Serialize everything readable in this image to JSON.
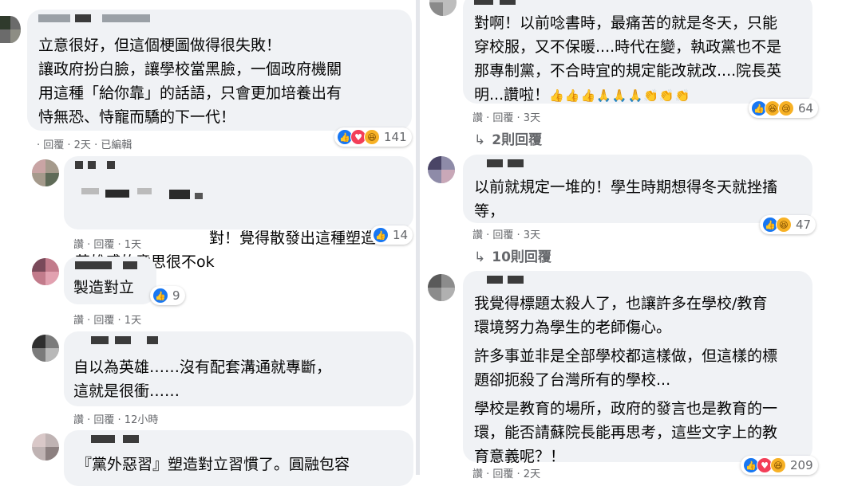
{
  "left_column": {
    "comment1": {
      "text": "立意很好，但這個梗圖做得很失敗！\n讓政府扮白臉，讓學校當黑臉，一個政府機關\n用這種「給你靠」的話語，只會更加培養出有\n恃無恐、恃寵而驕的下一代！",
      "meta": "· 回覆 · 2天 · 已編輯",
      "reaction_count": "141"
    },
    "comment2": {
      "text": "對！覺得散發出這種塑造\n英雄感的意思很不ok",
      "meta": "讚 · 回覆 · 1天",
      "reaction_count": "14"
    },
    "comment3": {
      "text": "製造對立",
      "meta": "讚 · 回覆 · 1天",
      "reaction_count": "9"
    },
    "comment4": {
      "text": "自以為英雄……沒有配套溝通就專斷，\n這就是很衝……",
      "meta": "讚 · 回覆 · 12小時"
    },
    "comment5": {
      "text": "『黨外惡習』塑造對立習慣了。圓融包容"
    }
  },
  "right_column": {
    "comment1": {
      "text": "對啊！以前唸書時，最痛苦的就是冬天，只能\n穿校服，又不保暖....時代在變，執政黨也不是\n那專制黨，不合時宜的規定能改就改....院長英\n明...讚啦！",
      "emojis": "👍👍👍🙏🙏🙏👏👏👏",
      "meta": "讚 · 回覆 · 3天",
      "reaction_count": "64",
      "replies": "2則回覆"
    },
    "comment2": {
      "text": "以前就規定一堆的！學生時期想得冬天就挫搐\n等，",
      "meta": "讚 · 回覆 · 3天",
      "reaction_count": "47",
      "replies": "10則回覆"
    },
    "comment3": {
      "para1": "我覺得標題太殺人了，也讓許多在學校/教育\n環境努力為學生的老師傷心。",
      "para2": "許多事並非是全部學校都這樣做，但這樣的標\n題卻扼殺了台灣所有的學校...",
      "para3": "學校是教育的場所，政府的發言也是教育的一\n環，能否請蘇院長能再思考，這些文字上的教\n育意義呢？！",
      "meta": "讚 · 回覆 · 2天",
      "reaction_count": "209"
    }
  },
  "icons": {
    "like": "👍",
    "love": "♥",
    "haha": "😆",
    "reply_arrow": "↳"
  },
  "colors": {
    "bubble_bg": "#f0f2f5",
    "meta_text": "#65676b",
    "like_blue": "#1877f2",
    "love_red": "#f33e58",
    "haha_yellow": "#f7b125"
  }
}
